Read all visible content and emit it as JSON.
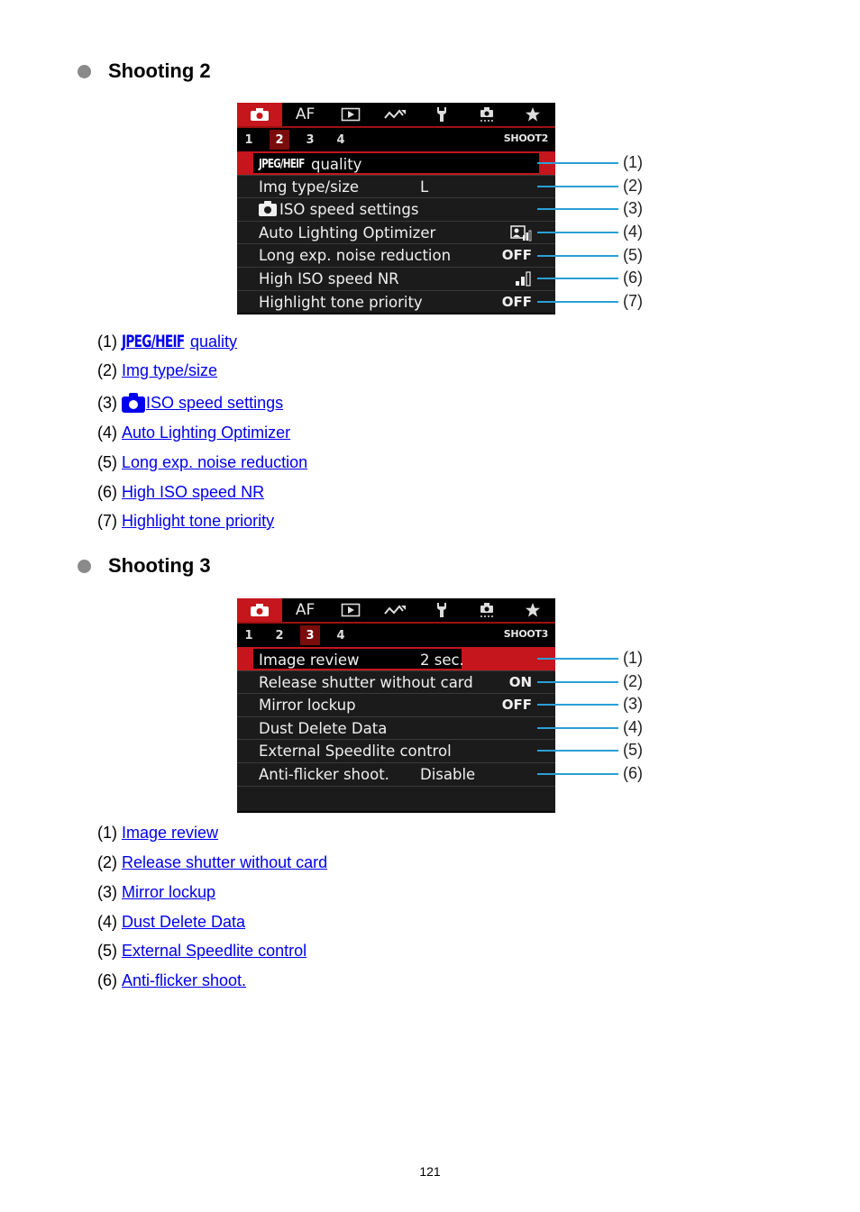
{
  "sections": [
    {
      "title": "Shooting 2",
      "screen": {
        "tabs": [
          {
            "icon": "camera-icon",
            "active": true
          },
          {
            "label": "AF"
          },
          {
            "icon": "playback-icon"
          },
          {
            "icon": "wireless-icon"
          },
          {
            "icon": "wrench-icon"
          },
          {
            "icon": "custom-functions-icon"
          },
          {
            "icon": "star-icon"
          }
        ],
        "subtabs": [
          "1",
          "2",
          "3",
          "4"
        ],
        "active_subtab": "2",
        "screen_id": "SHOOT2",
        "rows": [
          {
            "badge": "JPEG/HEIF",
            "label": "quality",
            "value": "",
            "selected": true
          },
          {
            "label": "Img type/size",
            "value": "L"
          },
          {
            "prefix_icon": "camera-icon",
            "label": "ISO speed settings",
            "value": ""
          },
          {
            "label": "Auto Lighting Optimizer",
            "value_icon": "alo-icon"
          },
          {
            "label": "Long exp. noise reduction",
            "value": "OFF"
          },
          {
            "label": "High ISO speed NR",
            "value_icon": "nr-level-icon"
          },
          {
            "label": "Highlight tone priority",
            "value": "OFF"
          }
        ],
        "callouts": [
          "(1)",
          "(2)",
          "(3)",
          "(4)",
          "(5)",
          "(6)",
          "(7)"
        ]
      },
      "refs": [
        {
          "num": "(1)",
          "badge": "JPEG/HEIF",
          "text": " quality"
        },
        {
          "num": "(2)",
          "text": "Img type/size"
        },
        {
          "num": "(3)",
          "prefix_icon": "camera-icon",
          "text": "ISO speed settings"
        },
        {
          "num": "(4)",
          "text": "Auto Lighting Optimizer"
        },
        {
          "num": "(5)",
          "text": "Long exp. noise reduction"
        },
        {
          "num": "(6)",
          "text": "High ISO speed NR"
        },
        {
          "num": "(7)",
          "text": "Highlight tone priority"
        }
      ]
    },
    {
      "title": "Shooting 3",
      "screen": {
        "tabs": [
          {
            "icon": "camera-icon",
            "active": true
          },
          {
            "label": "AF"
          },
          {
            "icon": "playback-icon"
          },
          {
            "icon": "wireless-icon"
          },
          {
            "icon": "wrench-icon"
          },
          {
            "icon": "custom-functions-icon"
          },
          {
            "icon": "star-icon"
          }
        ],
        "subtabs": [
          "1",
          "2",
          "3",
          "4"
        ],
        "active_subtab": "3",
        "screen_id": "SHOOT3",
        "rows": [
          {
            "label": "Image review",
            "value": "2 sec.",
            "selected": true
          },
          {
            "label": "Release shutter without card",
            "value": "ON"
          },
          {
            "label": "Mirror lockup",
            "value": "OFF"
          },
          {
            "label": "Dust Delete Data",
            "value": ""
          },
          {
            "label": "External Speedlite control",
            "value": ""
          },
          {
            "label": "Anti-flicker shoot.",
            "value": "Disable"
          }
        ],
        "callouts": [
          "(1)",
          "(2)",
          "(3)",
          "(4)",
          "(5)",
          "(6)"
        ]
      },
      "refs": [
        {
          "num": "(1)",
          "text": "Image review"
        },
        {
          "num": "(2)",
          "text": "Release shutter without card"
        },
        {
          "num": "(3)",
          "text": "Mirror lockup"
        },
        {
          "num": "(4)",
          "text": "Dust Delete Data"
        },
        {
          "num": "(5)",
          "text": "External Speedlite control"
        },
        {
          "num": "(6)",
          "text": "Anti-flicker shoot."
        }
      ]
    }
  ],
  "tab_af_label": "AF",
  "page_number": "121"
}
